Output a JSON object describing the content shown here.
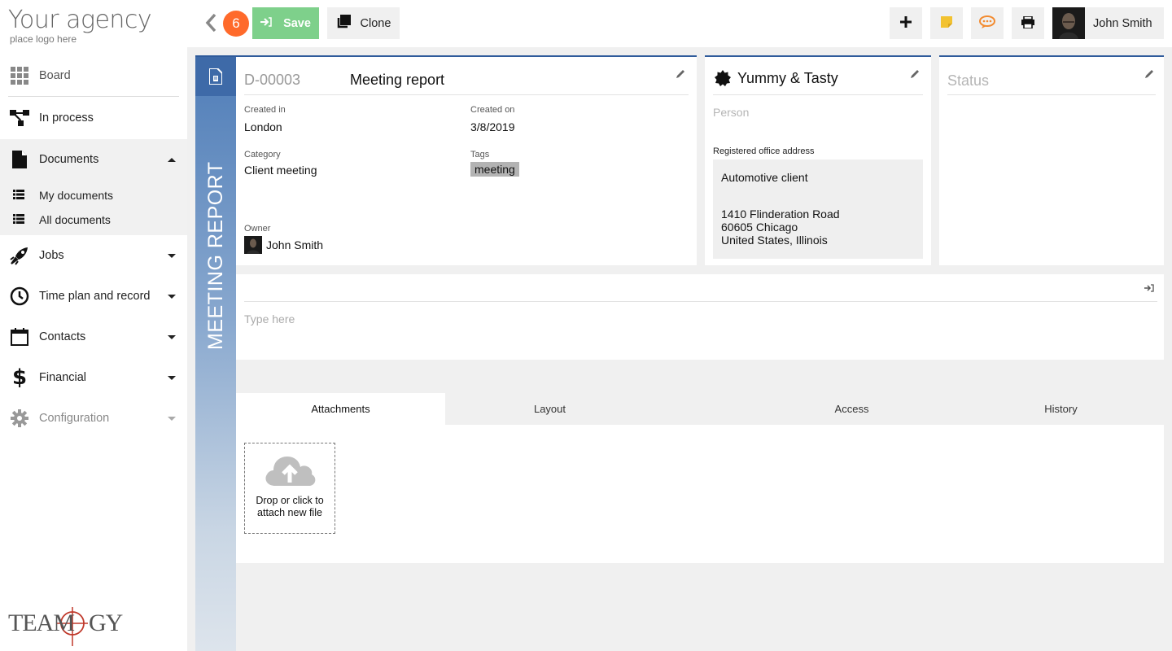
{
  "sidebar": {
    "logo_main": "Your agency",
    "logo_sub": "place logo here",
    "items": [
      {
        "label": "Board"
      },
      {
        "label": "In process"
      },
      {
        "label": "Documents"
      },
      {
        "label": "My documents"
      },
      {
        "label": "All documents"
      },
      {
        "label": "Jobs"
      },
      {
        "label": "Time plan and record"
      },
      {
        "label": "Contacts"
      },
      {
        "label": "Financial"
      },
      {
        "label": "Configuration"
      }
    ],
    "brand": "TEAMOGY"
  },
  "toolbar": {
    "badge_count": "6",
    "save_label": "Save",
    "clone_label": "Clone",
    "user_name": "John Smith",
    "colors": {
      "save": "#7ed08b",
      "badge": "#ff6a2b",
      "note": "#f2c230",
      "chat": "#f28b30"
    }
  },
  "document": {
    "vertical_tab_label": "MEETING REPORT",
    "id": "D-00003",
    "title": "Meeting report",
    "created_in_label": "Created in",
    "created_in": "London",
    "created_on_label": "Created on",
    "created_on": "3/8/2019",
    "category_label": "Category",
    "category": "Client meeting",
    "tags_label": "Tags",
    "tags": [
      "meeting"
    ],
    "owner_label": "Owner",
    "owner": "John Smith"
  },
  "company": {
    "name": "Yummy & Tasty",
    "person_placeholder": "Person",
    "address_label": "Registered office address",
    "address_name": "Automotive client",
    "address_line1": "1410  Flinderation Road",
    "address_line2": "60605 Chicago",
    "address_line3": "United States, Illinois"
  },
  "status": {
    "placeholder": "Status"
  },
  "notes": {
    "placeholder": "Type here"
  },
  "tabs": [
    {
      "label": "Attachments",
      "active": true
    },
    {
      "label": "Layout"
    },
    {
      "label": "Access"
    },
    {
      "label": "History"
    }
  ],
  "attachments": {
    "drop_line1": "Drop or click to",
    "drop_line2": "attach new file"
  }
}
